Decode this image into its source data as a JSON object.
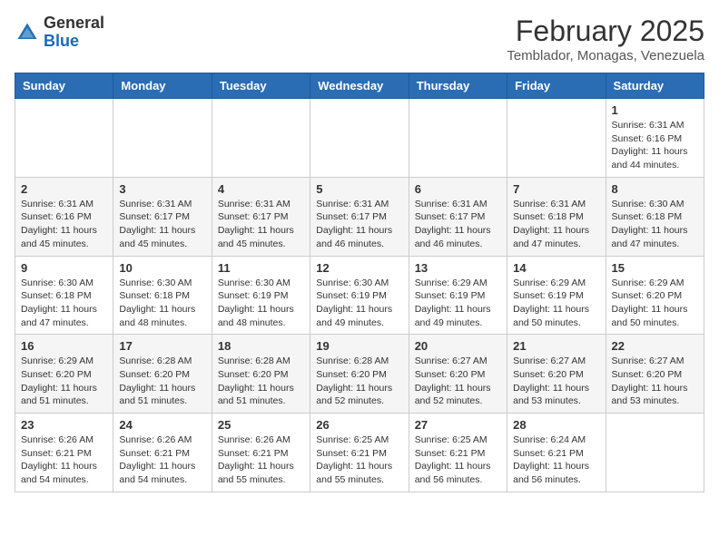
{
  "header": {
    "logo_general": "General",
    "logo_blue": "Blue",
    "month_title": "February 2025",
    "location": "Temblador, Monagas, Venezuela"
  },
  "days_of_week": [
    "Sunday",
    "Monday",
    "Tuesday",
    "Wednesday",
    "Thursday",
    "Friday",
    "Saturday"
  ],
  "weeks": [
    [
      {
        "day": "",
        "info": ""
      },
      {
        "day": "",
        "info": ""
      },
      {
        "day": "",
        "info": ""
      },
      {
        "day": "",
        "info": ""
      },
      {
        "day": "",
        "info": ""
      },
      {
        "day": "",
        "info": ""
      },
      {
        "day": "1",
        "info": "Sunrise: 6:31 AM\nSunset: 6:16 PM\nDaylight: 11 hours\nand 44 minutes."
      }
    ],
    [
      {
        "day": "2",
        "info": "Sunrise: 6:31 AM\nSunset: 6:16 PM\nDaylight: 11 hours\nand 45 minutes."
      },
      {
        "day": "3",
        "info": "Sunrise: 6:31 AM\nSunset: 6:17 PM\nDaylight: 11 hours\nand 45 minutes."
      },
      {
        "day": "4",
        "info": "Sunrise: 6:31 AM\nSunset: 6:17 PM\nDaylight: 11 hours\nand 45 minutes."
      },
      {
        "day": "5",
        "info": "Sunrise: 6:31 AM\nSunset: 6:17 PM\nDaylight: 11 hours\nand 46 minutes."
      },
      {
        "day": "6",
        "info": "Sunrise: 6:31 AM\nSunset: 6:17 PM\nDaylight: 11 hours\nand 46 minutes."
      },
      {
        "day": "7",
        "info": "Sunrise: 6:31 AM\nSunset: 6:18 PM\nDaylight: 11 hours\nand 47 minutes."
      },
      {
        "day": "8",
        "info": "Sunrise: 6:30 AM\nSunset: 6:18 PM\nDaylight: 11 hours\nand 47 minutes."
      }
    ],
    [
      {
        "day": "9",
        "info": "Sunrise: 6:30 AM\nSunset: 6:18 PM\nDaylight: 11 hours\nand 47 minutes."
      },
      {
        "day": "10",
        "info": "Sunrise: 6:30 AM\nSunset: 6:18 PM\nDaylight: 11 hours\nand 48 minutes."
      },
      {
        "day": "11",
        "info": "Sunrise: 6:30 AM\nSunset: 6:19 PM\nDaylight: 11 hours\nand 48 minutes."
      },
      {
        "day": "12",
        "info": "Sunrise: 6:30 AM\nSunset: 6:19 PM\nDaylight: 11 hours\nand 49 minutes."
      },
      {
        "day": "13",
        "info": "Sunrise: 6:29 AM\nSunset: 6:19 PM\nDaylight: 11 hours\nand 49 minutes."
      },
      {
        "day": "14",
        "info": "Sunrise: 6:29 AM\nSunset: 6:19 PM\nDaylight: 11 hours\nand 50 minutes."
      },
      {
        "day": "15",
        "info": "Sunrise: 6:29 AM\nSunset: 6:20 PM\nDaylight: 11 hours\nand 50 minutes."
      }
    ],
    [
      {
        "day": "16",
        "info": "Sunrise: 6:29 AM\nSunset: 6:20 PM\nDaylight: 11 hours\nand 51 minutes."
      },
      {
        "day": "17",
        "info": "Sunrise: 6:28 AM\nSunset: 6:20 PM\nDaylight: 11 hours\nand 51 minutes."
      },
      {
        "day": "18",
        "info": "Sunrise: 6:28 AM\nSunset: 6:20 PM\nDaylight: 11 hours\nand 51 minutes."
      },
      {
        "day": "19",
        "info": "Sunrise: 6:28 AM\nSunset: 6:20 PM\nDaylight: 11 hours\nand 52 minutes."
      },
      {
        "day": "20",
        "info": "Sunrise: 6:27 AM\nSunset: 6:20 PM\nDaylight: 11 hours\nand 52 minutes."
      },
      {
        "day": "21",
        "info": "Sunrise: 6:27 AM\nSunset: 6:20 PM\nDaylight: 11 hours\nand 53 minutes."
      },
      {
        "day": "22",
        "info": "Sunrise: 6:27 AM\nSunset: 6:20 PM\nDaylight: 11 hours\nand 53 minutes."
      }
    ],
    [
      {
        "day": "23",
        "info": "Sunrise: 6:26 AM\nSunset: 6:21 PM\nDaylight: 11 hours\nand 54 minutes."
      },
      {
        "day": "24",
        "info": "Sunrise: 6:26 AM\nSunset: 6:21 PM\nDaylight: 11 hours\nand 54 minutes."
      },
      {
        "day": "25",
        "info": "Sunrise: 6:26 AM\nSunset: 6:21 PM\nDaylight: 11 hours\nand 55 minutes."
      },
      {
        "day": "26",
        "info": "Sunrise: 6:25 AM\nSunset: 6:21 PM\nDaylight: 11 hours\nand 55 minutes."
      },
      {
        "day": "27",
        "info": "Sunrise: 6:25 AM\nSunset: 6:21 PM\nDaylight: 11 hours\nand 56 minutes."
      },
      {
        "day": "28",
        "info": "Sunrise: 6:24 AM\nSunset: 6:21 PM\nDaylight: 11 hours\nand 56 minutes."
      },
      {
        "day": "",
        "info": ""
      }
    ]
  ]
}
